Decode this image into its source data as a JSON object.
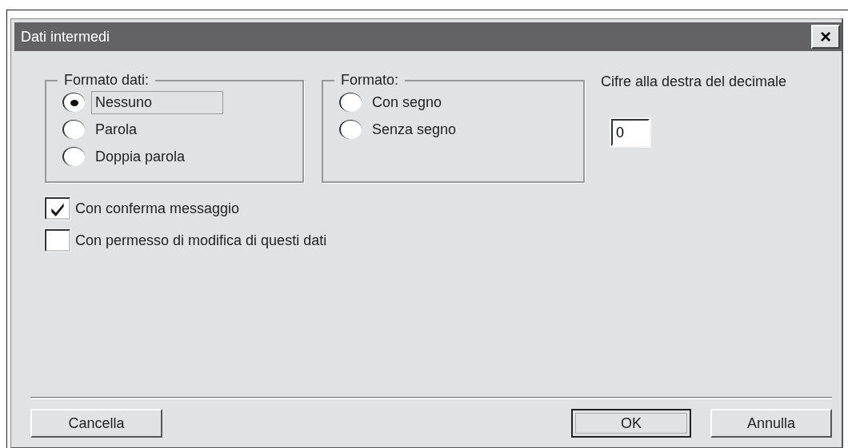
{
  "window": {
    "title": "Dati intermedi",
    "close": "×"
  },
  "data_format": {
    "title": "Formato dati:",
    "options": [
      {
        "label": "Nessuno",
        "selected": true,
        "focused": true
      },
      {
        "label": "Parola",
        "selected": false,
        "focused": false
      },
      {
        "label": "Doppia parola",
        "selected": false,
        "focused": false
      }
    ]
  },
  "format": {
    "title": "Formato:",
    "options": [
      {
        "label": "Con segno",
        "selected": false
      },
      {
        "label": "Senza segno",
        "selected": false
      }
    ]
  },
  "decimals": {
    "label": "Cifre alla destra del decimale",
    "value": "0"
  },
  "checkboxes": [
    {
      "label": "Con conferma  messaggio",
      "checked": true
    },
    {
      "label": "Con permesso di modifica di questi dati",
      "checked": false
    }
  ],
  "buttons": [
    {
      "label": "Cancella",
      "default": false
    },
    {
      "label": "OK",
      "default": true
    },
    {
      "label": "Annulla",
      "default": false
    }
  ]
}
